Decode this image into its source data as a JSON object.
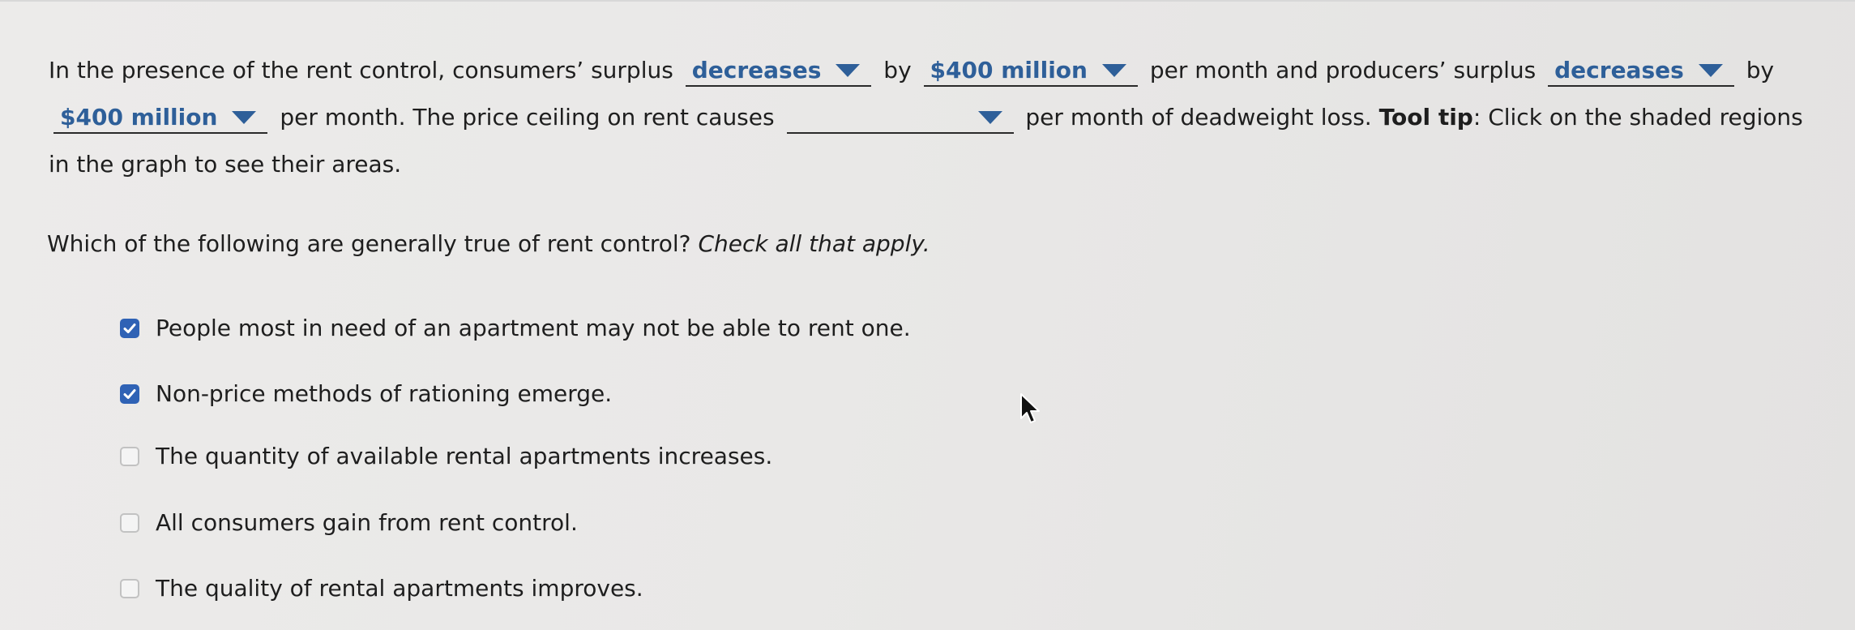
{
  "sentence": {
    "p1": "In the presence of the rent control, consumers’ surplus",
    "dd1": "decreases",
    "p2": "by",
    "dd2": "$400 million",
    "p3": "per month and producers’ surplus",
    "dd3": "decreases",
    "p4": "by",
    "dd4": "$400 million",
    "p5": "per month. The price ceiling on rent causes",
    "dd5": "",
    "p6": "per month of deadweight loss.",
    "tip_label": "Tool tip",
    "tip_text": ": Click on the shaded regions in the graph to see their areas."
  },
  "question": {
    "text": "Which of the following are generally true of rent control?",
    "instruction": "Check all that apply."
  },
  "options": [
    {
      "label": "People most in need of an apartment may not be able to rent one.",
      "checked": true
    },
    {
      "label": "Non-price methods of rationing emerge.",
      "checked": true
    },
    {
      "label": "The quantity of available rental apartments increases.",
      "checked": false
    },
    {
      "label": "All consumers gain from rent control.",
      "checked": false
    },
    {
      "label": "The quality of rental apartments improves.",
      "checked": false
    }
  ],
  "colors": {
    "accent": "#2e5f99",
    "checkbox_checked": "#2f62b5",
    "text": "#1e1e1e"
  }
}
